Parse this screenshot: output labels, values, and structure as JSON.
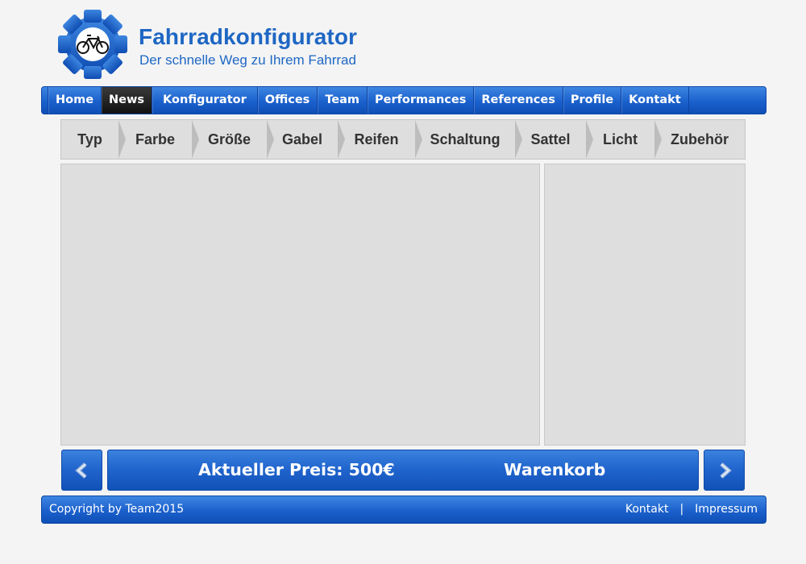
{
  "header": {
    "title": "Fahrradkonfigurator",
    "subtitle": "Der schnelle Weg zu Ihrem Fahrrad",
    "logo_icon": "gear-bicycle-icon",
    "brand_color": "#1e67c4"
  },
  "nav": {
    "items": [
      {
        "label": "Home"
      },
      {
        "label": "News",
        "active": true
      },
      {
        "label": "Konfigurator"
      },
      {
        "label": "Offices"
      },
      {
        "label": "Team"
      },
      {
        "label": "Performances"
      },
      {
        "label": "References"
      },
      {
        "label": "Profile"
      },
      {
        "label": "Kontakt"
      }
    ]
  },
  "steps": {
    "items": [
      {
        "label": "Typ"
      },
      {
        "label": "Farbe"
      },
      {
        "label": "Größe"
      },
      {
        "label": "Gabel"
      },
      {
        "label": "Reifen"
      },
      {
        "label": "Schaltung"
      },
      {
        "label": "Sattel"
      },
      {
        "label": "Licht"
      },
      {
        "label": "Zubehör"
      }
    ]
  },
  "bottom_bar": {
    "prev_icon": "chevron-left-icon",
    "next_icon": "chevron-right-icon",
    "price_label": "Aktueller Preis: 500€",
    "cart_label": "Warenkorb"
  },
  "footer": {
    "copyright": "Copyright by Team2015",
    "link_contact": "Kontakt",
    "separator": "|",
    "link_imprint": "Impressum"
  },
  "colors": {
    "bar_blue": "#1b60cc",
    "active_tab": "#1a1a1a",
    "panel_gray": "#dedede",
    "page_bg": "#f4f4f4"
  }
}
